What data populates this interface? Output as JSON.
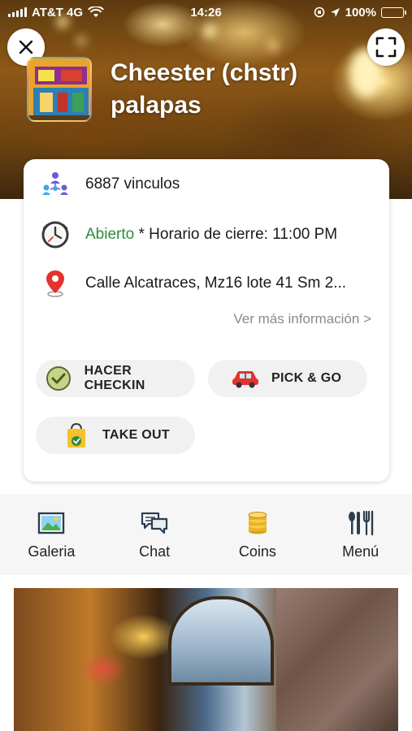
{
  "status_bar": {
    "carrier": "AT&T 4G",
    "time": "14:26",
    "battery": "100%"
  },
  "header": {
    "title": "Cheester (chstr) palapas",
    "close_icon": "close-icon",
    "scan_icon": "scan-frame-icon"
  },
  "info": {
    "links": "6887 vinculos",
    "status_open": "Abierto",
    "hours": " * Horario de cierre: 11:00 PM",
    "address": "Calle Alcatraces, Mz16 lote 41 Sm 2...",
    "more_link": "Ver más información >"
  },
  "actions": {
    "checkin": "HACER CHECKIN",
    "pickgo": "PICK & GO",
    "takeout": "TAKE OUT"
  },
  "tabs": [
    {
      "label": "Galeria",
      "icon": "gallery-icon"
    },
    {
      "label": "Chat",
      "icon": "chat-icon"
    },
    {
      "label": "Coins",
      "icon": "coins-icon"
    },
    {
      "label": "Menú",
      "icon": "menu-utensils-icon"
    }
  ],
  "colors": {
    "open_green": "#2e8b3d",
    "pill_bg": "#f1f1f1",
    "link_gray": "#8a8a8a"
  }
}
